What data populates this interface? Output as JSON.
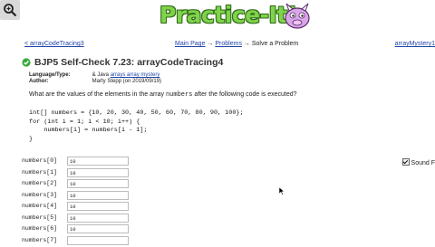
{
  "logo": {
    "text": "Practice-It!"
  },
  "nav": {
    "prev": "< arrayCodeTracing3",
    "main_page": "Main Page",
    "problems": "Problems",
    "arrow1": "→",
    "arrow2": "→",
    "current": "Solve a Problem",
    "next": "arrayMystery1"
  },
  "problem": {
    "title": "BJP5 Self-Check 7.23: arrayCodeTracing4",
    "language_type_label": "Language/Type:",
    "language_type_prefix": "& Java ",
    "language_type_links": "arrays array mystery",
    "author_label": "Author:",
    "author_value": "Marty Stepp (on 2019/09/19)",
    "question_pre": "What are the values of the elements in the array ",
    "question_var": "numbers",
    "question_post": " after the following code is executed?",
    "code": "int[] numbers = {10, 20, 30, 40, 50, 60, 70, 80, 90, 100};\nfor (int i = 1; i < 10; i++) {\n    numbers[i] = numbers[i - 1];\n}"
  },
  "answers": [
    {
      "label": "numbers[0]",
      "value": "10"
    },
    {
      "label": "numbers[1]",
      "value": "10"
    },
    {
      "label": "numbers[2]",
      "value": "10"
    },
    {
      "label": "numbers[3]",
      "value": "10"
    },
    {
      "label": "numbers[4]",
      "value": "10"
    },
    {
      "label": "numbers[5]",
      "value": "10"
    },
    {
      "label": "numbers[6]",
      "value": "10"
    },
    {
      "label": "numbers[7]",
      "value": ""
    }
  ],
  "sound": {
    "label": "Sound F",
    "checked": true
  },
  "colors": {
    "link": "#2244aa",
    "logo_green": "#7fd34a",
    "check_green": "#3aa83a"
  }
}
